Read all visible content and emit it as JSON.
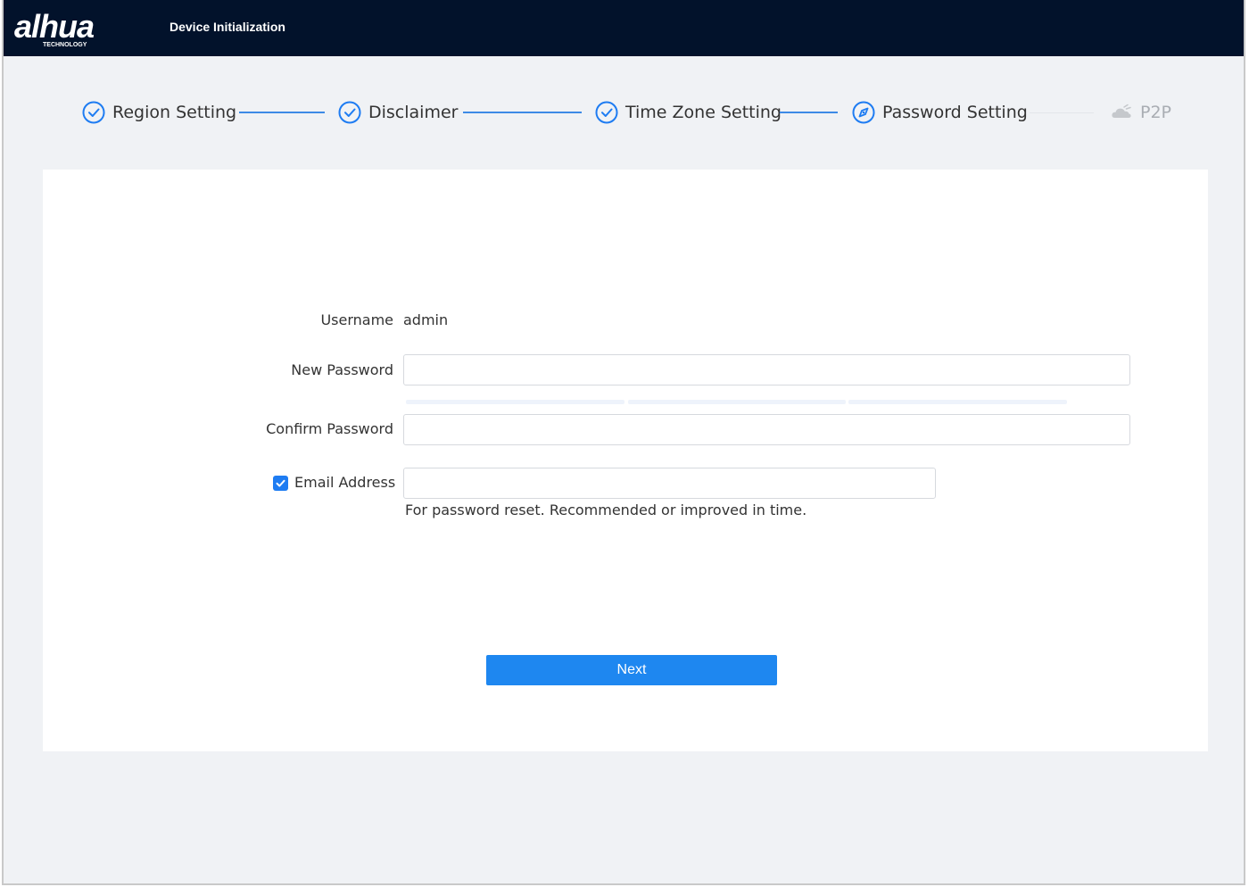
{
  "header": {
    "logo_text": "alhua",
    "logo_subtext": "TECHNOLOGY",
    "title": "Device Initialization"
  },
  "steps": [
    {
      "label": "Region Setting",
      "state": "done",
      "icon": "check-circle-icon"
    },
    {
      "label": "Disclaimer",
      "state": "done",
      "icon": "check-circle-icon"
    },
    {
      "label": "Time Zone Setting",
      "state": "done",
      "icon": "check-circle-icon"
    },
    {
      "label": "Password Setting",
      "state": "current",
      "icon": "compass-icon"
    },
    {
      "label": "P2P",
      "state": "pending",
      "icon": "cloud-icon"
    }
  ],
  "form": {
    "username_label": "Username",
    "username_value": "admin",
    "new_password_label": "New Password",
    "new_password_value": "",
    "confirm_password_label": "Confirm Password",
    "confirm_password_value": "",
    "email_label": "Email Address",
    "email_checked": true,
    "email_value": "",
    "email_hint": "For password reset. Recommended or improved in time."
  },
  "actions": {
    "next_label": "Next"
  },
  "colors": {
    "header_bg": "#02122b",
    "accent": "#1e87f0",
    "page_bg": "#f0f2f5"
  }
}
